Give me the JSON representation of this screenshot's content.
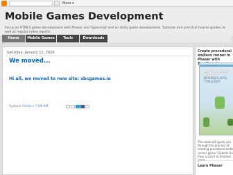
{
  "navbar": {
    "more_label": "More ▾"
  },
  "header": {
    "title": "Mobile Games Development",
    "description": "Focus on HTML5 game development with Phaser and Typescript and on Unity game development. Tutorials and practical how-to guides as well as regular index reports."
  },
  "tabs": [
    {
      "label": "Home",
      "active": true
    },
    {
      "label": "Mobile Games",
      "active": false
    },
    {
      "label": "Tools",
      "active": false
    },
    {
      "label": "Downloads",
      "active": false
    }
  ],
  "post": {
    "date": "Saturday, January 11, 2020",
    "title": "We moved...",
    "body_prefix": "Hi all, we moved to new site: ",
    "body_link": "sbcgames.io",
    "footer_prefix": "Vystavil",
    "author": "Cmdo",
    "time": "7:09 AM"
  },
  "sidebar": {
    "widget1_title": "Create procedural endless runner in Phaser with TypeScript",
    "book_title": "ENDLESS RUN",
    "book_subtitle": "IN PHASER WITH TYPESCRIPT",
    "widget1_text": "This book will guide you through the process of creating procedural endless runner game \"Gobolin Run\" from scratch to finished game",
    "widget2_title": "Learn Phaser"
  },
  "colors": {
    "accent": "#0066cc",
    "tab_bg": "#444444",
    "tab_active": "#777777"
  }
}
